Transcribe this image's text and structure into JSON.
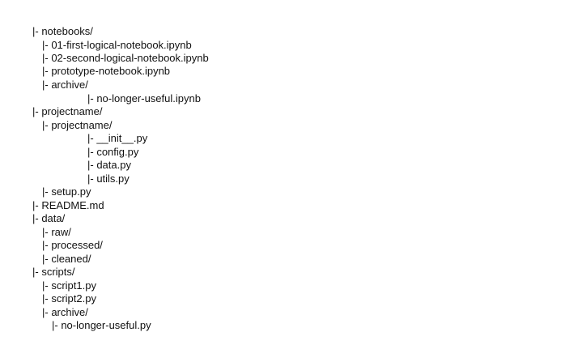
{
  "tree": {
    "lines": [
      "|- notebooks/",
      "|- 01-first-logical-notebook.ipynb",
      "|- 02-second-logical-notebook.ipynb",
      "|- prototype-notebook.ipynb",
      "|- archive/",
      "|- no-longer-useful.ipynb",
      "|- projectname/",
      "|- projectname/",
      "|- __init__.py",
      "|- config.py",
      "|- data.py",
      "|- utils.py",
      "|- setup.py",
      "|- README.md",
      "|- data/",
      "|- raw/",
      "|- processed/",
      "|- cleaned/",
      "|- scripts/",
      "|- script1.py",
      "|- script2.py",
      "|- archive/",
      "|- no-longer-useful.py"
    ]
  }
}
